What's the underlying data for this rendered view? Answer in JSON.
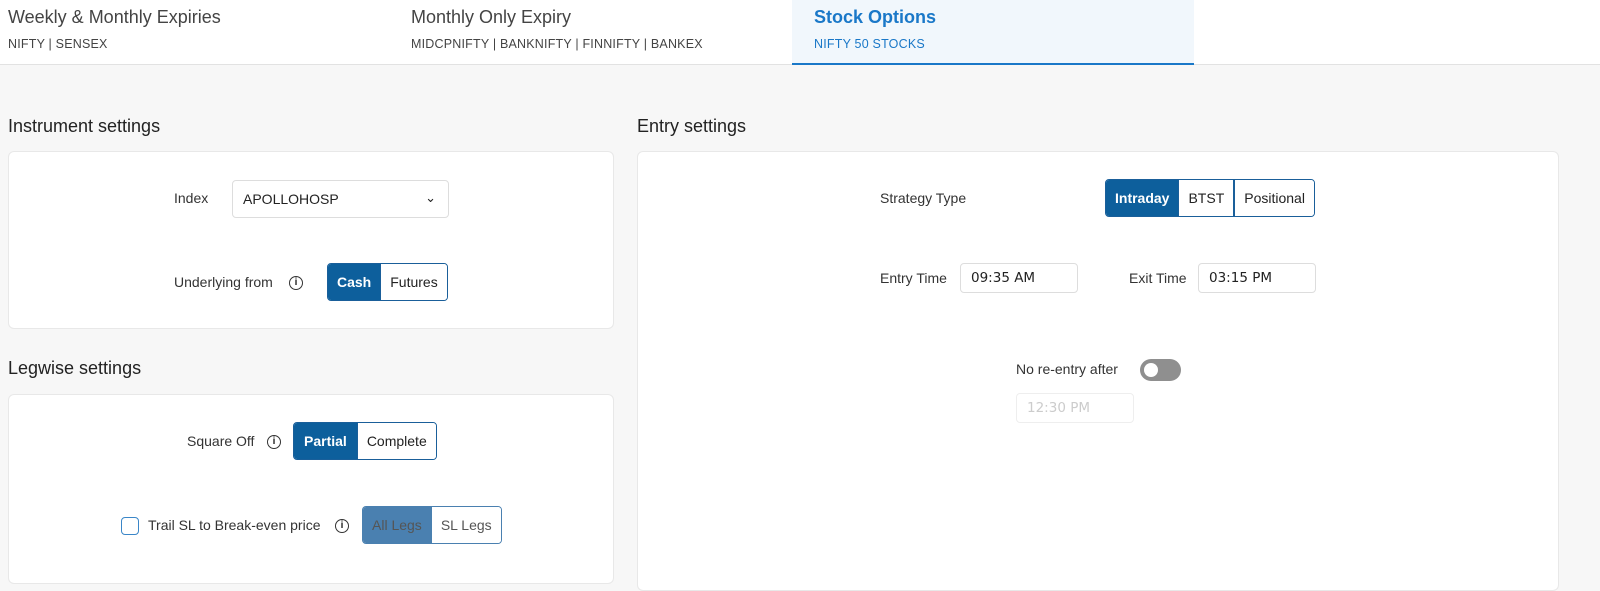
{
  "tabs": [
    {
      "title": "Weekly & Monthly Expiries",
      "sub": "NIFTY | SENSEX"
    },
    {
      "title": "Monthly Only Expiry",
      "sub": "MIDCPNIFTY | BANKNIFTY | FINNIFTY | BANKEX"
    },
    {
      "title": "Stock Options",
      "sub": "NIFTY 50 STOCKS"
    }
  ],
  "instrument": {
    "title": "Instrument settings",
    "index_label": "Index",
    "index_value": "APOLLOHOSP",
    "underlying_label": "Underlying from",
    "underlying_options": [
      "Cash",
      "Futures"
    ],
    "underlying_selected": "Cash"
  },
  "legwise": {
    "title": "Legwise settings",
    "squareoff_label": "Square Off",
    "squareoff_options": [
      "Partial",
      "Complete"
    ],
    "squareoff_selected": "Partial",
    "trail_label": "Trail SL to Break-even price",
    "trail_checked": false,
    "trail_options": [
      "All Legs",
      "SL Legs"
    ],
    "trail_selected": "All Legs"
  },
  "entry": {
    "title": "Entry settings",
    "strategy_label": "Strategy Type",
    "strategy_options": [
      "Intraday",
      "BTST",
      "Positional"
    ],
    "strategy_selected": "Intraday",
    "entry_time_label": "Entry Time",
    "entry_time": "09:35 AM",
    "exit_time_label": "Exit Time",
    "exit_time": "03:15 PM",
    "noreentry_label": "No re-entry after",
    "noreentry_enabled": false,
    "noreentry_time": "12:30 PM"
  },
  "colors": {
    "accent": "#1a78c8",
    "selected": "#0d5f9c"
  }
}
